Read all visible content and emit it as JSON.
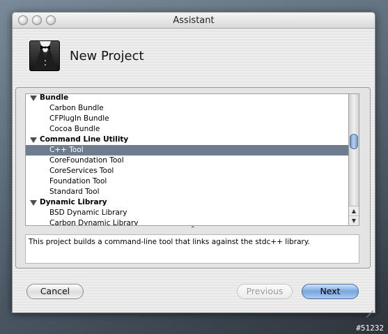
{
  "window": {
    "title": "Assistant"
  },
  "header": {
    "icon": "tuxedo-icon",
    "title": "New Project"
  },
  "template_list": {
    "rows": [
      {
        "type": "category",
        "label": "Bundle"
      },
      {
        "type": "item",
        "label": "Carbon Bundle"
      },
      {
        "type": "item",
        "label": "CFPlugIn Bundle"
      },
      {
        "type": "item",
        "label": "Cocoa Bundle"
      },
      {
        "type": "category",
        "label": "Command Line Utility"
      },
      {
        "type": "item",
        "label": "C++ Tool",
        "selected": true
      },
      {
        "type": "item",
        "label": "CoreFoundation Tool"
      },
      {
        "type": "item",
        "label": "CoreServices Tool"
      },
      {
        "type": "item",
        "label": "Foundation Tool"
      },
      {
        "type": "item",
        "label": "Standard Tool"
      },
      {
        "type": "category",
        "label": "Dynamic Library"
      },
      {
        "type": "item",
        "label": "BSD Dynamic Library"
      },
      {
        "type": "item",
        "label": "Carbon Dynamic Library"
      }
    ]
  },
  "description": "This project builds a command-line tool that links against the stdc++ library.",
  "buttons": {
    "cancel": "Cancel",
    "previous": "Previous",
    "next": "Next"
  },
  "badge": "#51232",
  "colors": {
    "selection": "#6d7c8f",
    "default_button": "#7aa6dc"
  }
}
